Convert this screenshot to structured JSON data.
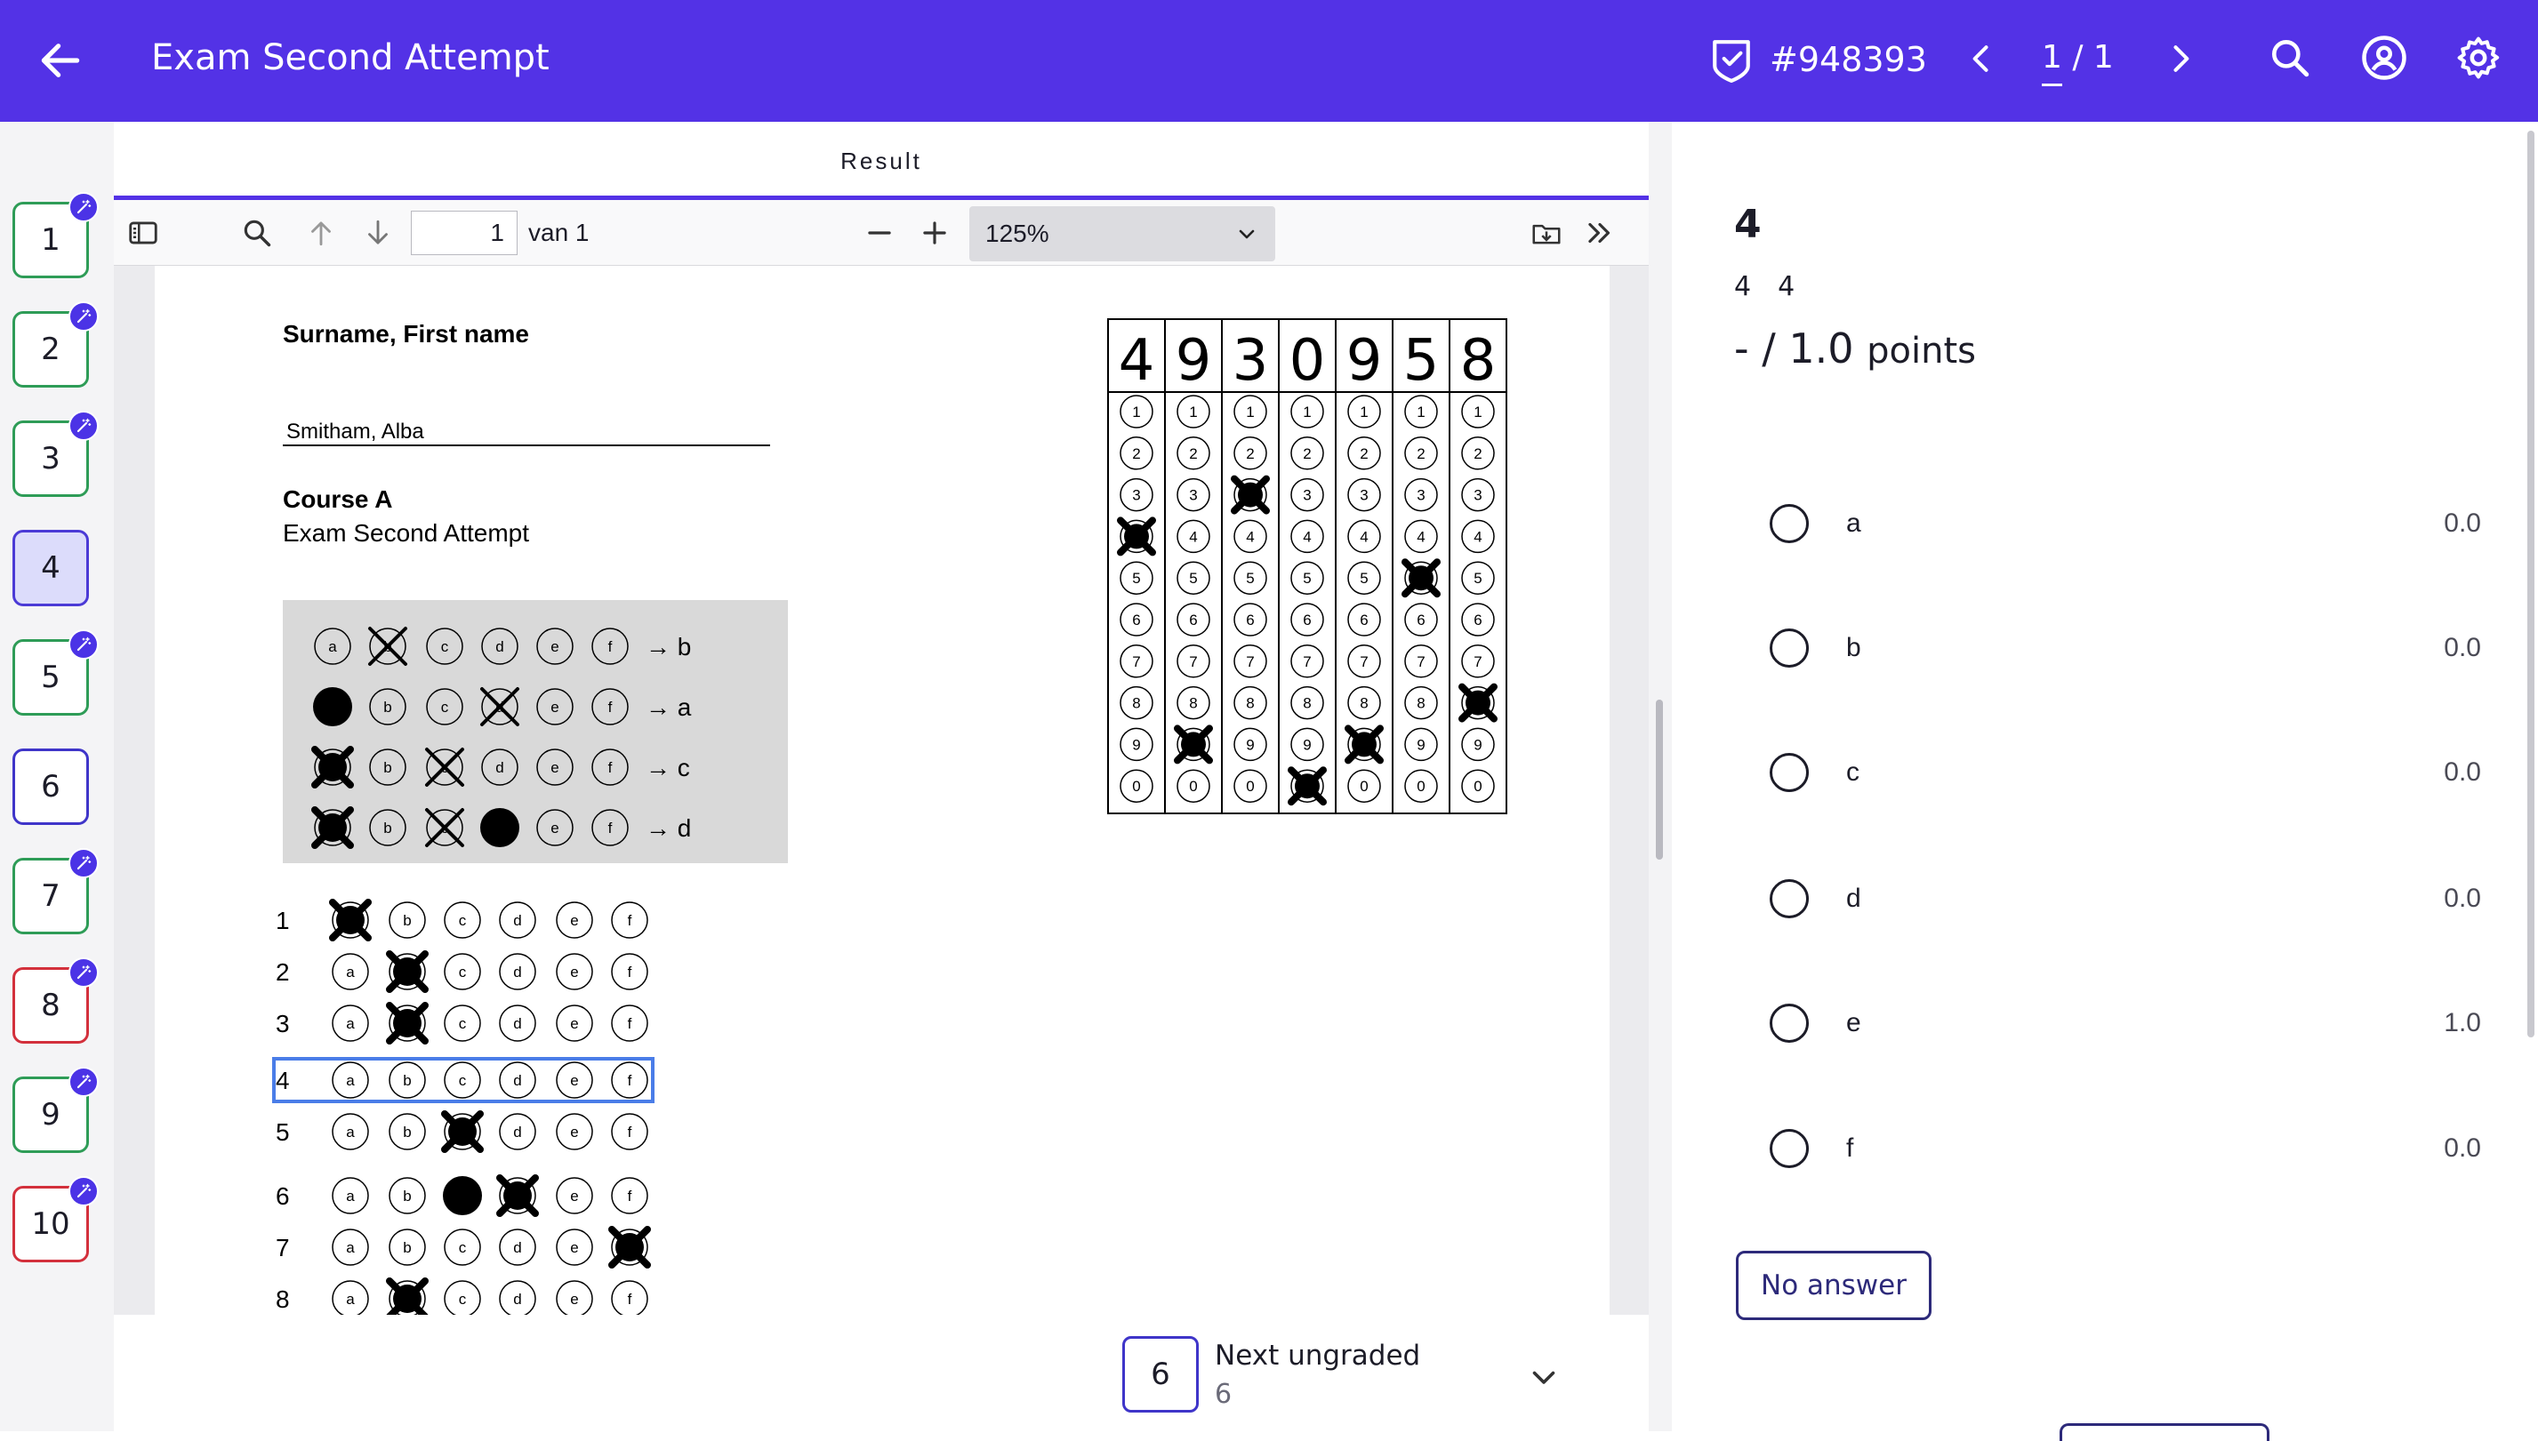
{
  "header": {
    "title": "Exam Second Attempt",
    "sheet_id": "#948393",
    "page_current": "1",
    "page_sep": " / ",
    "page_total": "1"
  },
  "question_nav": [
    {
      "num": "1",
      "status": "green",
      "badge": true
    },
    {
      "num": "2",
      "status": "green",
      "badge": true
    },
    {
      "num": "3",
      "status": "green",
      "badge": true
    },
    {
      "num": "4",
      "status": "active",
      "badge": false
    },
    {
      "num": "5",
      "status": "green",
      "badge": true
    },
    {
      "num": "6",
      "status": "blue",
      "badge": false
    },
    {
      "num": "7",
      "status": "green",
      "badge": true
    },
    {
      "num": "8",
      "status": "red",
      "badge": true
    },
    {
      "num": "9",
      "status": "green",
      "badge": true
    },
    {
      "num": "10",
      "status": "red",
      "badge": true
    }
  ],
  "viewer": {
    "tab": "Result",
    "page_input": "1",
    "page_of": "van 1",
    "zoom": "125%"
  },
  "sheet": {
    "name_label": "Surname, First name",
    "name_value": "Smitham, Alba",
    "course": "Course A",
    "exam": "Exam Second Attempt",
    "student_number_written": [
      "4",
      "9",
      "3",
      "0",
      "9",
      "5",
      "8"
    ],
    "example_rows": [
      {
        "arrow": "→ b"
      },
      {
        "arrow": "→ a"
      },
      {
        "arrow": "→ c"
      },
      {
        "arrow": "→ d"
      }
    ],
    "answer_rows": [
      "1",
      "2",
      "3",
      "4",
      "5",
      "6",
      "7",
      "8"
    ],
    "bubble_letters": [
      "a",
      "b",
      "c",
      "d",
      "e",
      "f"
    ],
    "digit_rows": [
      "1",
      "2",
      "3",
      "4",
      "5",
      "6",
      "7",
      "8",
      "9",
      "0"
    ]
  },
  "next_ungraded": {
    "question": "6",
    "label": "Next ungraded",
    "count": "6"
  },
  "question_panel": {
    "title": "4",
    "sub_a": "4",
    "sub_b": "4",
    "score": "- / 1.0",
    "score_unit": "points",
    "options": [
      {
        "label": "a",
        "points": "0.0"
      },
      {
        "label": "b",
        "points": "0.0"
      },
      {
        "label": "c",
        "points": "0.0"
      },
      {
        "label": "d",
        "points": "0.0"
      },
      {
        "label": "e",
        "points": "1.0"
      },
      {
        "label": "f",
        "points": "0.0"
      }
    ],
    "no_answer": "No answer"
  },
  "colors": {
    "brand": "#5332e6",
    "green": "#2e9c57",
    "red": "#d3303c",
    "blue": "#3f35c9",
    "highlight": "#4a7de8"
  }
}
